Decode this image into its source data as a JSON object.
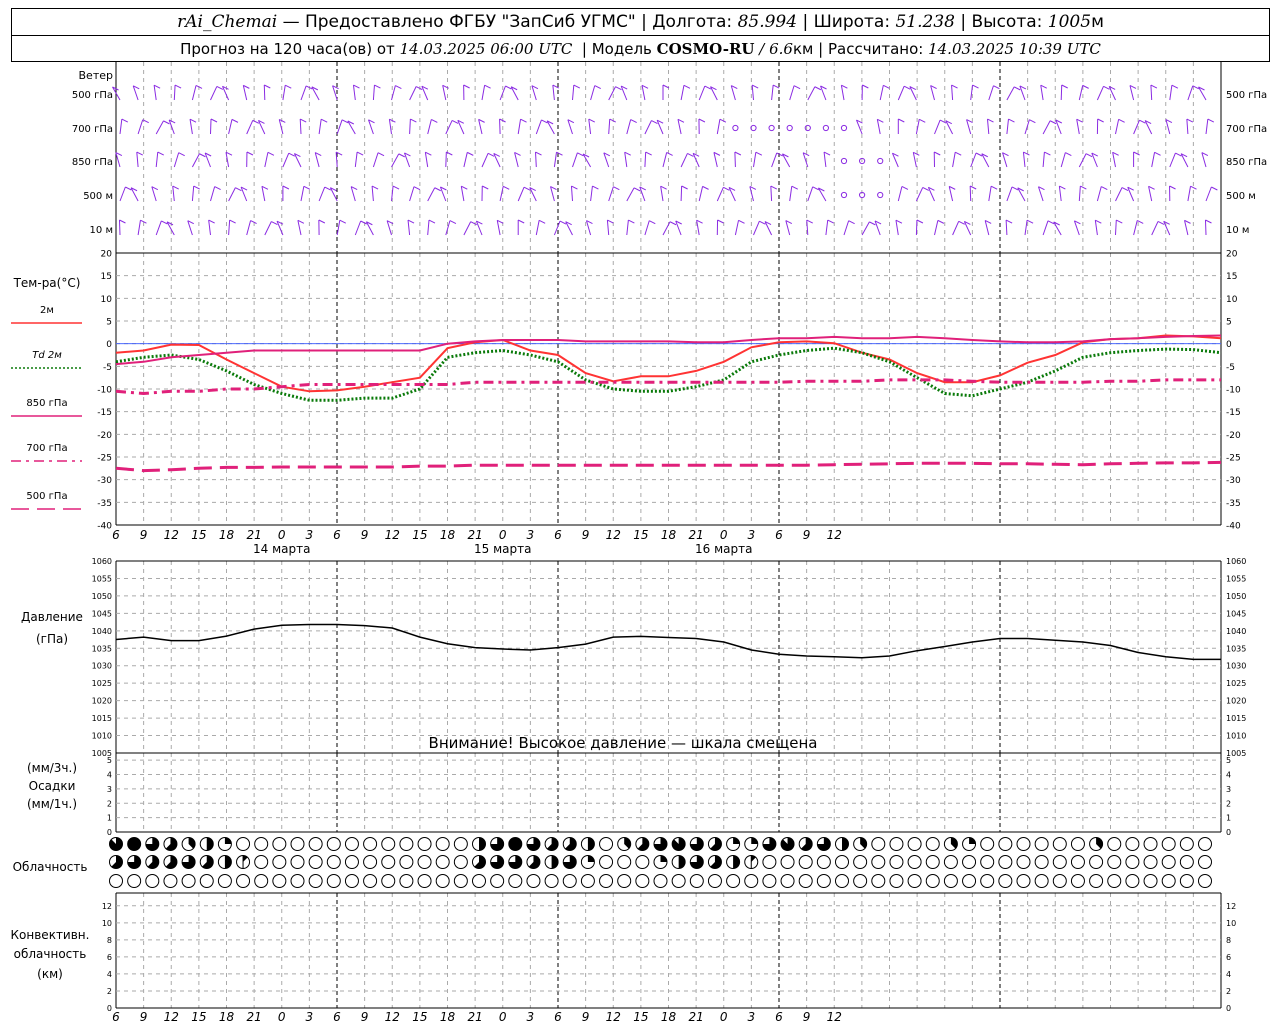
{
  "header": {
    "station": "rAi_Chemai",
    "provider": "— Предоставлено ФГБУ \"ЗапСиб УГМС\"",
    "lon_label": "Долгота:",
    "lon_value": "85.994",
    "lat_label": "Широта:",
    "lat_value": "51.238",
    "alt_label": "Высота:",
    "alt_value": "1005",
    "alt_unit": "м",
    "forecast_prefix": "Прогноз на 120 часа(ов) от",
    "forecast_start": "14.03.2025 06:00 UTC",
    "model_label": "Модель",
    "model_name": "COSMO-RU",
    "model_res": "/ 6.6",
    "model_res_unit": "км",
    "calc_label": "Рассчитано:",
    "calc_time": "14.03.2025 10:39 UTC"
  },
  "wind": {
    "title": "Ветер",
    "levels": [
      "500 гПа",
      "700 гПа",
      "850 гПа",
      "500 м",
      "10 м"
    ],
    "color": "#8a2be2"
  },
  "temperature": {
    "title": "Тем-ра(°C)",
    "legend": [
      {
        "label": "2м",
        "color": "#ff3333",
        "style": "solid"
      },
      {
        "label": "Td  2м",
        "color": "#0a7a0a",
        "style": "dotted"
      },
      {
        "label": "850 гПа",
        "color": "#e0207a",
        "style": "solid"
      },
      {
        "label": "700 гПа",
        "color": "#e0207a",
        "style": "dashdot"
      },
      {
        "label": "500 гПа",
        "color": "#e0207a",
        "style": "dashed"
      }
    ]
  },
  "x_axis": {
    "tick_labels": [
      "6",
      "9",
      "12",
      "15",
      "18",
      "21",
      "0",
      "3",
      "6",
      "9",
      "12",
      "15",
      "18",
      "21",
      "0",
      "3",
      "6",
      "9",
      "12",
      "15",
      "18",
      "21",
      "0",
      "3",
      "6",
      "9",
      "12"
    ],
    "date_labels": [
      "14 марта",
      "15 марта",
      "16 марта"
    ]
  },
  "pressure": {
    "title_1": "Давление",
    "title_2": "(гПа)",
    "warning": "Внимание! Высокое давление — шкала смещена"
  },
  "precip": {
    "unit_3h": "(мм/3ч.)",
    "title": "Осадки",
    "unit_1h": "(мм/1ч.)"
  },
  "cloud": {
    "title": "Облачность"
  },
  "convective": {
    "title_1": "Конвективн.",
    "title_2": "облачность",
    "title_3": "(км)"
  },
  "chart_data": [
    {
      "type": "line",
      "title": "",
      "ylabel": "Тем-ра(°C)",
      "ylim": [
        -40,
        20
      ],
      "y_ticks": [
        20,
        15,
        10,
        5,
        0,
        -5,
        -10,
        -15,
        -20,
        -25,
        -30,
        -35,
        -40
      ],
      "x_hours": [
        0,
        3,
        6,
        9,
        12,
        15,
        18,
        21,
        24,
        27,
        30,
        33,
        36,
        39,
        42,
        45,
        48,
        51,
        54,
        57,
        60,
        63,
        66,
        69,
        72,
        75,
        78,
        81,
        84,
        87,
        90,
        93,
        96,
        99,
        102,
        105,
        108,
        111,
        114,
        117,
        120
      ],
      "series": [
        {
          "name": "2м",
          "color": "#ff3333",
          "style": "solid",
          "values": [
            -2,
            -1.5,
            -0.2,
            -0.3,
            -3.5,
            -6.5,
            -9.5,
            -10.5,
            -10.3,
            -9.5,
            -8.5,
            -7.5,
            -1,
            0.3,
            0.8,
            -1.5,
            -2.5,
            -6.5,
            -8.3,
            -7.2,
            -7.2,
            -6,
            -4,
            -0.8,
            0.3,
            0.5,
            0.1,
            -2,
            -3.5,
            -6.5,
            -8.5,
            -8.5,
            -7,
            -4.2,
            -2.5,
            0.3,
            1,
            1.2,
            1.8,
            1.6,
            1.2
          ]
        },
        {
          "name": "Td  2м",
          "color": "#0a7a0a",
          "style": "dotted",
          "values": [
            -4,
            -3,
            -2.5,
            -3.5,
            -6,
            -9,
            -11,
            -12.5,
            -12.5,
            -12,
            -12,
            -10,
            -3,
            -2,
            -1.5,
            -2.5,
            -4,
            -8,
            -10,
            -10.5,
            -10.5,
            -9.5,
            -8,
            -4,
            -2.5,
            -1.5,
            -1,
            -2,
            -4,
            -7.5,
            -11,
            -11.5,
            -10,
            -8.5,
            -6,
            -3,
            -2,
            -1.5,
            -1.2,
            -1.3,
            -2
          ]
        },
        {
          "name": "850 гПа",
          "color": "#e0207a",
          "style": "solid",
          "values": [
            -4.5,
            -4,
            -3,
            -2.5,
            -2,
            -1.5,
            -1.5,
            -1.5,
            -1.5,
            -1.5,
            -1.5,
            -1.5,
            0,
            0.5,
            0.8,
            0.8,
            0.8,
            0.5,
            0.5,
            0.5,
            0.5,
            0.3,
            0.3,
            0.8,
            1.2,
            1.2,
            1.5,
            1.2,
            1.2,
            1.5,
            1.2,
            0.8,
            0.5,
            0.3,
            0.3,
            0.5,
            1,
            1.2,
            1.5,
            1.7,
            1.8
          ]
        },
        {
          "name": "700 гПа",
          "color": "#e0207a",
          "style": "dashdot",
          "values": [
            -10.5,
            -11,
            -10.5,
            -10.5,
            -10,
            -10,
            -9.5,
            -9,
            -9,
            -9,
            -9,
            -9,
            -9,
            -8.5,
            -8.5,
            -8.5,
            -8.5,
            -8.5,
            -8.5,
            -8.5,
            -8.5,
            -8.5,
            -8.5,
            -8.5,
            -8.5,
            -8.3,
            -8.3,
            -8.3,
            -8,
            -8,
            -8,
            -8.3,
            -8.5,
            -8.5,
            -8.5,
            -8.5,
            -8.3,
            -8.3,
            -8,
            -8,
            -8
          ]
        },
        {
          "name": "500 гПа",
          "color": "#e0207a",
          "style": "dashed",
          "values": [
            -27.5,
            -28,
            -27.8,
            -27.5,
            -27.3,
            -27.3,
            -27.2,
            -27.2,
            -27.2,
            -27.2,
            -27.2,
            -27,
            -27,
            -26.8,
            -26.8,
            -26.8,
            -26.8,
            -26.8,
            -26.8,
            -26.8,
            -26.8,
            -26.8,
            -26.8,
            -26.8,
            -26.8,
            -26.8,
            -26.7,
            -26.6,
            -26.5,
            -26.4,
            -26.4,
            -26.4,
            -26.5,
            -26.5,
            -26.6,
            -26.7,
            -26.5,
            -26.4,
            -26.3,
            -26.3,
            -26.2
          ]
        }
      ]
    },
    {
      "type": "line",
      "title": "",
      "ylabel": "Давление (гПа)",
      "ylim": [
        1005,
        1060
      ],
      "y_ticks": [
        1060,
        1055,
        1050,
        1045,
        1040,
        1035,
        1030,
        1025,
        1020,
        1015,
        1010,
        1005
      ],
      "x_hours": [
        0,
        3,
        6,
        9,
        12,
        15,
        18,
        21,
        24,
        27,
        30,
        33,
        36,
        39,
        42,
        45,
        48,
        51,
        54,
        57,
        60,
        63,
        66,
        69,
        72,
        75,
        78,
        81,
        84,
        87,
        90,
        93,
        96,
        99,
        102,
        105,
        108,
        111,
        114,
        117,
        120
      ],
      "series": [
        {
          "name": "",
          "color": "#000000",
          "style": "solid",
          "values": [
            1037.5,
            1038.2,
            1037.2,
            1037.2,
            1038.5,
            1040.5,
            1041.6,
            1041.8,
            1041.8,
            1041.5,
            1040.8,
            1038.2,
            1036.3,
            1035.2,
            1034.8,
            1034.5,
            1035.2,
            1036.2,
            1038.2,
            1038.4,
            1038.1,
            1037.8,
            1036.8,
            1034.5,
            1033.3,
            1032.8,
            1032.6,
            1032.3,
            1032.8,
            1034.3,
            1035.5,
            1036.8,
            1037.8,
            1037.8,
            1037.3,
            1036.8,
            1035.8,
            1033.8,
            1032.6,
            1031.8,
            1031.8
          ]
        }
      ]
    },
    {
      "type": "bar",
      "title": "",
      "ylabel": "Осадки (мм/3ч.) (мм/1ч.)",
      "ylim": [
        0,
        5
      ],
      "y_ticks": [
        5,
        4,
        3,
        2,
        1,
        0
      ],
      "values": []
    },
    {
      "type": "scatter",
      "title": "",
      "ylabel": "Облачность",
      "rows": 3,
      "columns": 61,
      "description_levels": [
        "upper",
        "middle",
        "lower"
      ],
      "cover_eighths": {
        "upper": [
          7,
          8,
          6,
          5,
          3,
          4,
          2,
          0,
          0,
          0,
          0,
          0,
          0,
          0,
          0,
          0,
          0,
          0,
          0,
          0,
          4,
          6,
          8,
          6,
          5,
          5,
          4,
          0,
          3,
          5,
          6,
          7,
          6,
          5,
          2,
          2,
          6,
          7,
          5,
          6,
          4,
          3,
          0,
          0,
          0,
          0,
          3,
          2,
          0,
          0,
          0,
          0,
          0,
          0,
          3,
          0,
          0,
          0,
          0,
          0,
          0
        ],
        "middle": [
          5,
          6,
          5,
          5,
          6,
          5,
          4,
          1,
          0,
          0,
          0,
          0,
          0,
          0,
          0,
          0,
          0,
          0,
          0,
          0,
          5,
          6,
          6,
          5,
          4,
          6,
          2,
          0,
          0,
          0,
          2,
          4,
          6,
          5,
          4,
          1,
          0,
          0,
          0,
          0,
          0,
          0,
          0,
          0,
          0,
          0,
          0,
          0,
          0,
          0,
          0,
          0,
          0,
          0,
          0,
          0,
          0,
          0,
          0,
          0,
          0
        ],
        "lower": [
          0,
          0,
          0,
          0,
          0,
          0,
          0,
          0,
          0,
          0,
          0,
          0,
          0,
          0,
          0,
          0,
          0,
          0,
          0,
          0,
          0,
          0,
          0,
          0,
          0,
          0,
          0,
          0,
          0,
          0,
          0,
          0,
          0,
          0,
          0,
          0,
          0,
          0,
          0,
          0,
          0,
          0,
          0,
          0,
          0,
          0,
          0,
          0,
          0,
          0,
          0,
          0,
          0,
          0,
          0,
          0,
          0,
          0,
          0,
          0,
          0
        ]
      }
    },
    {
      "type": "bar",
      "title": "",
      "ylabel": "Конвективн. облачность (км)",
      "ylim": [
        0,
        13
      ],
      "y_ticks": [
        12,
        10,
        8,
        6,
        4,
        2,
        0
      ],
      "values": []
    }
  ]
}
